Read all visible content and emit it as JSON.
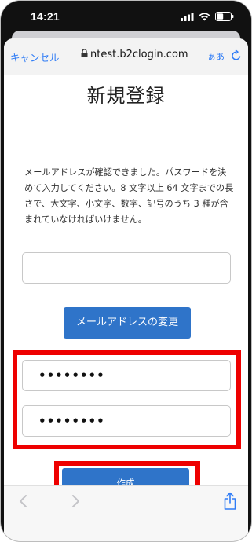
{
  "status_bar": {
    "time": "14:21"
  },
  "nav": {
    "cancel_label": "キャンセル",
    "url": "ntest.b2clogin.com",
    "text_size_label": "ぁあ"
  },
  "page": {
    "title": "新規登録",
    "intro": "メールアドレスが確認できました。パスワードを決めて入力してください。8 文字以上 64 文字までの長さで、大文字、小文字、数字、記号のうち 3 種が含まれていなければいけません。",
    "email_value": "",
    "change_email_label": "メールアドレスの変更",
    "password_value": "••••••••",
    "confirm_password_value": "••••••••",
    "create_label": "作成"
  },
  "colors": {
    "accent": "#2f7cf6",
    "button": "#2f74c9",
    "highlight": "#ee0000"
  },
  "icons": [
    "signal-icon",
    "wifi-icon",
    "battery-icon",
    "lock-icon",
    "reload-icon",
    "back-icon",
    "forward-icon",
    "share-icon"
  ]
}
